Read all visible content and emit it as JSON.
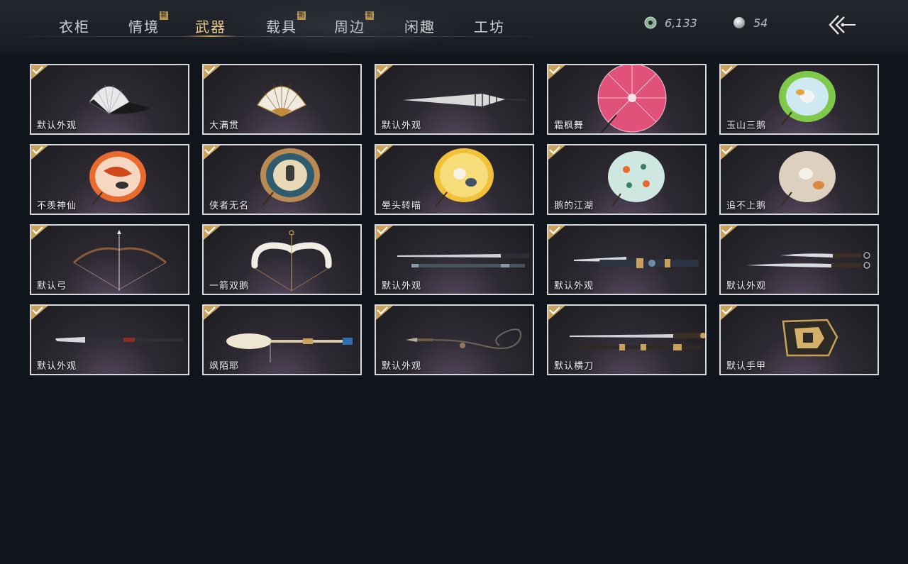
{
  "nav": {
    "tabs": [
      {
        "label": "衣柜",
        "new": false,
        "active": false
      },
      {
        "label": "情境",
        "new": true,
        "active": false
      },
      {
        "label": "武器",
        "new": false,
        "active": true
      },
      {
        "label": "载具",
        "new": true,
        "active": false
      },
      {
        "label": "周边",
        "new": true,
        "active": false
      },
      {
        "label": "闲趣",
        "new": false,
        "active": false
      },
      {
        "label": "工坊",
        "new": false,
        "active": false
      }
    ],
    "new_badge": "新"
  },
  "currency": {
    "jade": {
      "value": "6,133",
      "icon": "jade-coin-icon"
    },
    "pearl": {
      "value": "54",
      "icon": "pearl-icon"
    }
  },
  "back_icon": "back-arrow-icon",
  "items": [
    {
      "label": "默认外观",
      "icon": "folding-fan-icon",
      "owned": true
    },
    {
      "label": "大满贯",
      "icon": "folding-fan-icon",
      "owned": true
    },
    {
      "label": "默认外观",
      "icon": "closed-umbrella-icon",
      "owned": true
    },
    {
      "label": "霜枫舞",
      "icon": "umbrella-icon",
      "owned": true
    },
    {
      "label": "玉山三鹅",
      "icon": "umbrella-icon",
      "owned": true
    },
    {
      "label": "不羡神仙",
      "icon": "umbrella-icon",
      "owned": true
    },
    {
      "label": "侠者无名",
      "icon": "umbrella-icon",
      "owned": true
    },
    {
      "label": "晕头转喵",
      "icon": "umbrella-icon",
      "owned": true
    },
    {
      "label": "鹅的江湖",
      "icon": "umbrella-icon",
      "owned": true
    },
    {
      "label": "追不上鹅",
      "icon": "umbrella-icon",
      "owned": true
    },
    {
      "label": "默认弓",
      "icon": "bow-icon",
      "owned": true
    },
    {
      "label": "一箭双鹅",
      "icon": "bow-icon",
      "owned": true
    },
    {
      "label": "默认外观",
      "icon": "sword-icon",
      "owned": true
    },
    {
      "label": "默认外观",
      "icon": "sword-icon",
      "owned": true
    },
    {
      "label": "默认外观",
      "icon": "dual-blades-icon",
      "owned": true
    },
    {
      "label": "默认外观",
      "icon": "spear-icon",
      "owned": true
    },
    {
      "label": "飒陌耶",
      "icon": "spear-icon",
      "owned": true
    },
    {
      "label": "默认外观",
      "icon": "rope-dart-icon",
      "owned": true
    },
    {
      "label": "默认横刀",
      "icon": "sword-icon",
      "owned": true
    },
    {
      "label": "默认手甲",
      "icon": "gauntlet-icon",
      "owned": true
    }
  ]
}
